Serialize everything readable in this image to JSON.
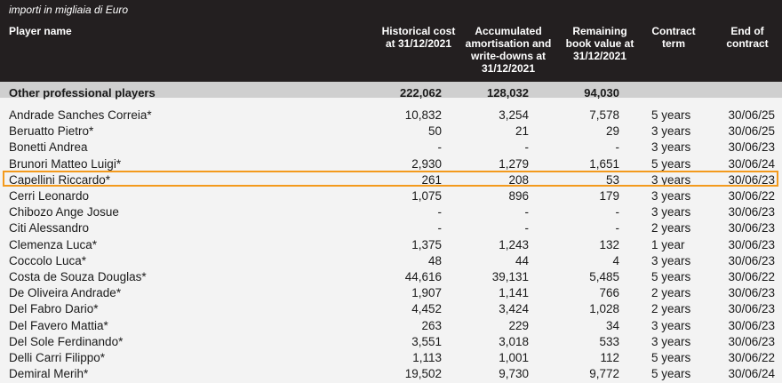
{
  "unit_note": "importi in migliaia di Euro",
  "headers": {
    "player_name": "Player name",
    "historical_cost": [
      "Historical cost",
      "at 31/12/2021"
    ],
    "accumulated": [
      "Accumulated",
      "amortisation and",
      "write-downs at",
      "31/12/2021"
    ],
    "remaining": [
      "Remaining",
      "book value at",
      "31/12/2021"
    ],
    "contract_term": [
      "Contract",
      "term"
    ],
    "end_of_contract": [
      "End of",
      "contract"
    ]
  },
  "summary": {
    "name": "Other professional players",
    "historical_cost": "222,062",
    "accumulated": "128,032",
    "remaining": "94,030"
  },
  "highlight_color": "#f39a1d",
  "rows": [
    {
      "name": "Andrade Sanches Correia*",
      "hist": "10,832",
      "accum": "3,254",
      "remain": "7,578",
      "term": "5 years",
      "end": "30/06/25"
    },
    {
      "name": "Beruatto Pietro*",
      "hist": "50",
      "accum": "21",
      "remain": "29",
      "term": "3 years",
      "end": "30/06/25"
    },
    {
      "name": "Bonetti Andrea",
      "hist": "-",
      "accum": "-",
      "remain": "-",
      "term": "3 years",
      "end": "30/06/23"
    },
    {
      "name": "Brunori Matteo Luigi*",
      "hist": "2,930",
      "accum": "1,279",
      "remain": "1,651",
      "term": "5 years",
      "end": "30/06/24"
    },
    {
      "name": "Capellini Riccardo*",
      "hist": "261",
      "accum": "208",
      "remain": "53",
      "term": "3 years",
      "end": "30/06/23"
    },
    {
      "name": "Cerri Leonardo",
      "hist": "1,075",
      "accum": "896",
      "remain": "179",
      "term": "3 years",
      "end": "30/06/22"
    },
    {
      "name": "Chibozo Ange Josue",
      "hist": "-",
      "accum": "-",
      "remain": "-",
      "term": "3 years",
      "end": "30/06/23"
    },
    {
      "name": "Citi Alessandro",
      "hist": "-",
      "accum": "-",
      "remain": "-",
      "term": "2 years",
      "end": "30/06/23"
    },
    {
      "name": "Clemenza Luca*",
      "hist": "1,375",
      "accum": "1,243",
      "remain": "132",
      "term": "1 year",
      "end": "30/06/23"
    },
    {
      "name": "Coccolo Luca*",
      "hist": "48",
      "accum": "44",
      "remain": "4",
      "term": "3 years",
      "end": "30/06/23"
    },
    {
      "name": "Costa de Souza Douglas*",
      "hist": "44,616",
      "accum": "39,131",
      "remain": "5,485",
      "term": "5 years",
      "end": "30/06/22"
    },
    {
      "name": "De Oliveira Andrade*",
      "hist": "1,907",
      "accum": "1,141",
      "remain": "766",
      "term": "2 years",
      "end": "30/06/23"
    },
    {
      "name": "Del Fabro Dario*",
      "hist": "4,452",
      "accum": "3,424",
      "remain": "1,028",
      "term": "2 years",
      "end": "30/06/23"
    },
    {
      "name": "Del Favero Mattia*",
      "hist": "263",
      "accum": "229",
      "remain": "34",
      "term": "3 years",
      "end": "30/06/23"
    },
    {
      "name": "Del Sole Ferdinando*",
      "hist": "3,551",
      "accum": "3,018",
      "remain": "533",
      "term": "3 years",
      "end": "30/06/23"
    },
    {
      "name": "Delli Carri Filippo*",
      "hist": "1,113",
      "accum": "1,001",
      "remain": "112",
      "term": "5 years",
      "end": "30/06/22"
    },
    {
      "name": "Demiral Merih*",
      "hist": "19,502",
      "accum": "9,730",
      "remain": "9,772",
      "term": "5 years",
      "end": "30/06/24"
    }
  ]
}
